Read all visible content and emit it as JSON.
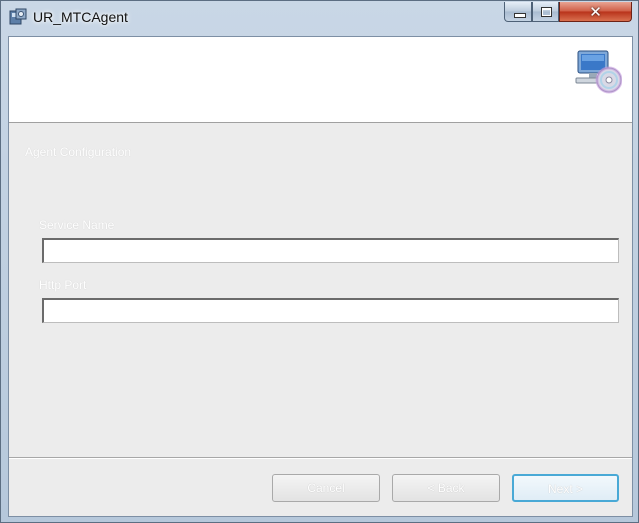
{
  "window": {
    "title": "UR_MTCAgent",
    "app_icon": "installer-icon",
    "buttons": {
      "minimize": "minimize-icon",
      "maximize": "maximize-icon",
      "close": "close-icon"
    }
  },
  "banner": {
    "icon": "computer-disc-icon"
  },
  "main": {
    "section_title": "Agent Configuration",
    "fields": [
      {
        "label": "Service Name",
        "value": ""
      },
      {
        "label": "Http Port",
        "value": ""
      }
    ]
  },
  "footer": {
    "cancel_label": "Cancel",
    "back_label": "< Back",
    "next_label": "Next >"
  },
  "colors": {
    "next_button_border": "#49a9d6",
    "close_button": "#c4442a"
  }
}
